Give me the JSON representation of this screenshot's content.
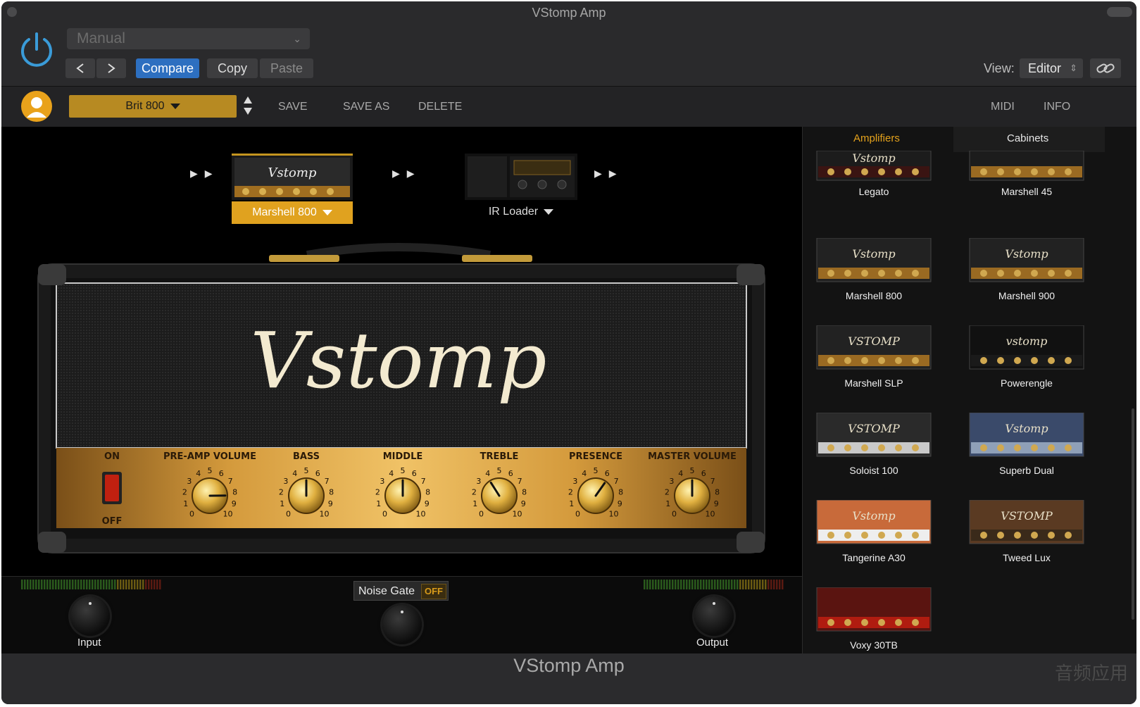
{
  "window": {
    "title": "VStomp Amp"
  },
  "host": {
    "preset_menu": "Manual",
    "compare": "Compare",
    "copy": "Copy",
    "paste": "Paste",
    "view_label": "View:",
    "view_value": "Editor"
  },
  "toolbar": {
    "preset": "Brit 800",
    "save": "SAVE",
    "save_as": "SAVE AS",
    "delete": "DELETE",
    "midi": "MIDI",
    "info": "INFO"
  },
  "chain": {
    "amp_thumb_logo": "Vstomp",
    "amp_slot": "Marshell 800",
    "ir_slot": "IR Loader"
  },
  "amp": {
    "logo": "Vstomp",
    "switch_on": "ON",
    "switch_off": "OFF",
    "controls": [
      {
        "label": "PRE-AMP VOLUME",
        "value": 8.3
      },
      {
        "label": "BASS",
        "value": 5.0
      },
      {
        "label": "MIDDLE",
        "value": 5.0
      },
      {
        "label": "TREBLE",
        "value": 3.8
      },
      {
        "label": "PRESENCE",
        "value": 6.3
      },
      {
        "label": "MASTER VOLUME",
        "value": 5.0
      }
    ],
    "scale": [
      "0",
      "1",
      "2",
      "3",
      "4",
      "5",
      "6",
      "7",
      "8",
      "9",
      "10"
    ]
  },
  "bottom": {
    "input": "Input",
    "output": "Output",
    "noise_gate": "Noise Gate",
    "noise_gate_state": "OFF"
  },
  "browser": {
    "tabs": [
      "Amplifiers",
      "Cabinets"
    ],
    "selected_tab": "Amplifiers",
    "items": [
      "Legato",
      "Marshell 45",
      "Marshell 800",
      "Marshell 900",
      "Marshell SLP",
      "Powerengle",
      "Soloist 100",
      "Superb Dual",
      "Tangerine A30",
      "Tweed Lux",
      "Voxy 30TB"
    ],
    "thumb_text": [
      "Vstomp",
      "Vstomp",
      "Vstomp",
      "VSTOMP",
      "vstomp",
      "VSTOMP",
      "Vstomp",
      "Vstomp",
      "VSTOMP"
    ]
  },
  "footer": {
    "title": "VStomp Amp",
    "watermark": "音频应用"
  },
  "colors": {
    "accent": "#e0a21f",
    "compare": "#2d6fc0",
    "power": "#3a9bd8"
  }
}
